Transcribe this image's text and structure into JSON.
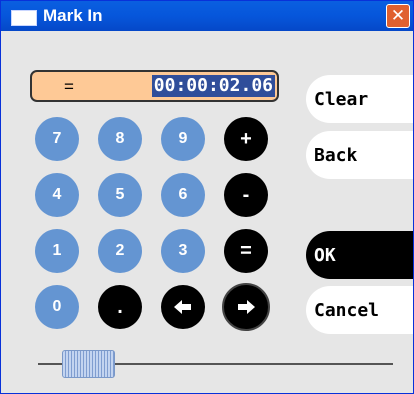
{
  "window": {
    "title": "Mark In"
  },
  "display": {
    "operator": "=",
    "time": "00:00:02.06"
  },
  "keypad": {
    "k7": "7",
    "k8": "8",
    "k9": "9",
    "plus": "+",
    "k4": "4",
    "k5": "5",
    "k6": "6",
    "minus": "-",
    "k1": "1",
    "k2": "2",
    "k3": "3",
    "equals": "=",
    "k0": "0",
    "dot": "."
  },
  "actions": {
    "clear": "Clear",
    "back": "Back",
    "ok": "OK",
    "cancel": "Cancel"
  },
  "icons": {
    "close": "close-icon",
    "left": "arrow-left-icon",
    "right": "arrow-right-icon",
    "app": "window-icon"
  },
  "colors": {
    "titlebar": "#0656db",
    "display_bg": "#fec996",
    "digit_key": "#6495d2",
    "op_key": "#000000"
  }
}
